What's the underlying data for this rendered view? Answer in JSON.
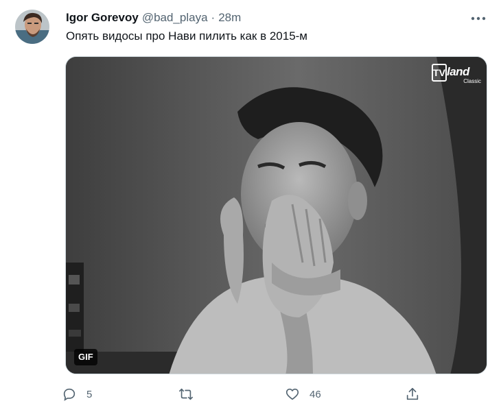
{
  "tweet": {
    "author_name": "Igor Gorevoy",
    "handle": "@bad_playa",
    "separator": "·",
    "time": "28m",
    "text": "Опять видосы про Нави пилить как в 2015-м"
  },
  "media": {
    "badge": "GIF",
    "watermark": {
      "tv": "TV",
      "land": "land",
      "sub": "Classic"
    }
  },
  "actions": {
    "reply_count": "5",
    "retweet_count": "",
    "like_count": "46"
  },
  "icons": {
    "more": "more-horizontal-icon",
    "reply": "reply-icon",
    "retweet": "retweet-icon",
    "like": "heart-icon",
    "share": "share-icon"
  },
  "colors": {
    "text": "#0f1419",
    "secondary": "#536471",
    "border": "#cfd9de"
  }
}
